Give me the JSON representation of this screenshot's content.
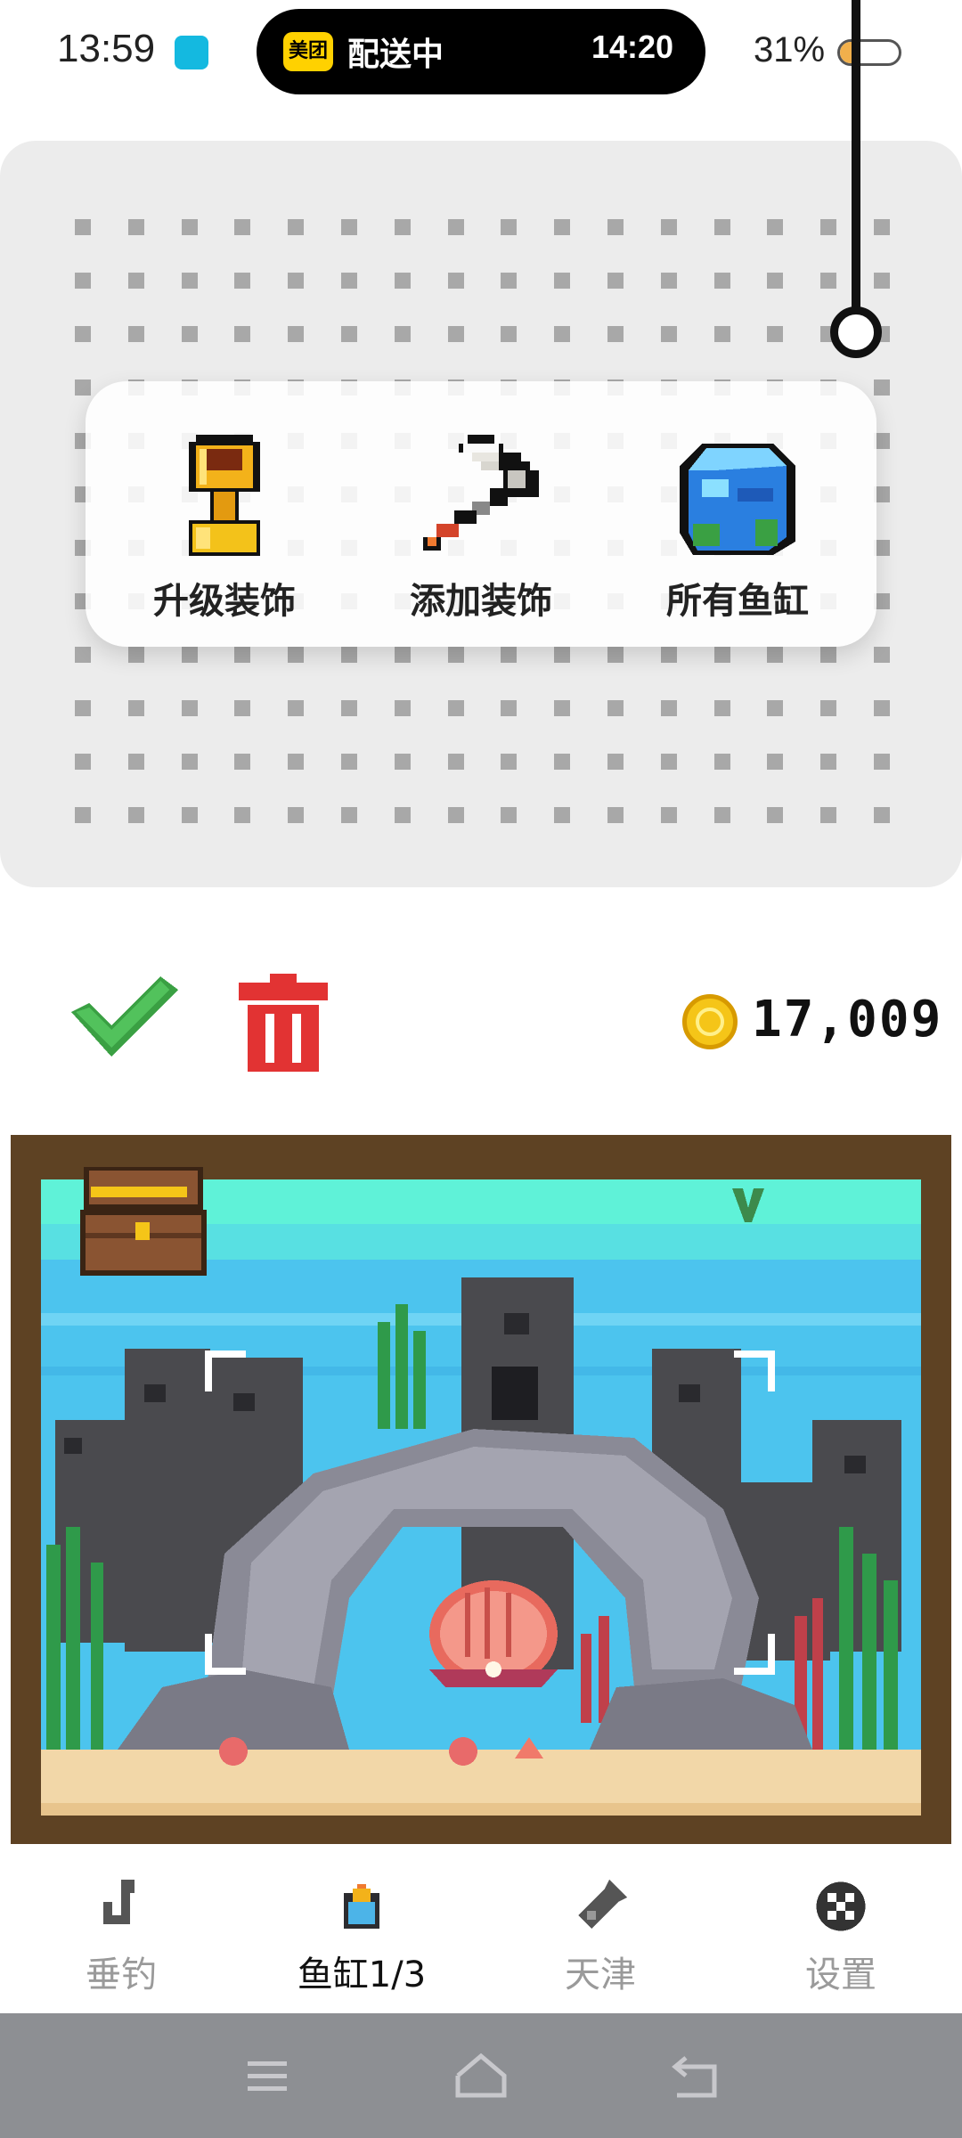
{
  "status_bar": {
    "time": "13:59",
    "pill_logo": "美团",
    "pill_text": "配送中",
    "pill_time": "14:20",
    "battery_percent": "31%",
    "battery_level": 0.31
  },
  "menu": {
    "items": [
      {
        "label": "升级装饰",
        "icon": "golden-trophy-icon"
      },
      {
        "label": "添加装饰",
        "icon": "paint-roller-icon"
      },
      {
        "label": "所有鱼缸",
        "icon": "aquarium-cube-icon"
      }
    ]
  },
  "actions": {
    "confirm_icon": "checkmark-icon",
    "delete_icon": "trash-icon"
  },
  "coins": {
    "icon": "coin-icon",
    "value": "17,009"
  },
  "tank": {
    "decorations": [
      "treasure-chest",
      "castle",
      "rock-arch",
      "clam-shell",
      "seaweed",
      "coral",
      "starfish"
    ]
  },
  "tabs": [
    {
      "label": "垂钓",
      "icon": "hook-icon",
      "active": false
    },
    {
      "label": "鱼缸1/3",
      "icon": "fishbowl-icon",
      "active": true
    },
    {
      "label": "天津",
      "icon": "bottle-icon",
      "active": false
    },
    {
      "label": "设置",
      "icon": "settings-ball-icon",
      "active": false
    }
  ],
  "colors": {
    "water_top": "#5ff2d8",
    "water": "#4cc4ee",
    "sand": "#f2d7a8",
    "tank_frame": "#5e4223",
    "check": "#3aa043",
    "trash": "#e23333",
    "coin": "#f5c518"
  }
}
